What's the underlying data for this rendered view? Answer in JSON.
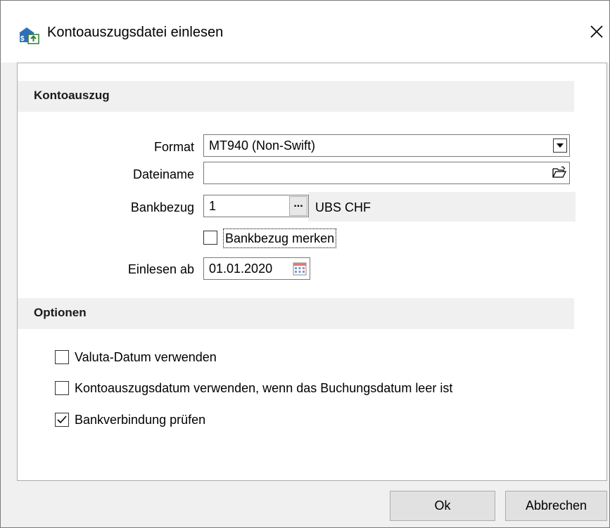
{
  "window": {
    "title": "Kontoauszugsdatei einlesen",
    "icon": "bank-import-icon",
    "close_icon": "close-icon"
  },
  "section_kontoauszug": {
    "header": "Kontoauszug",
    "format_label": "Format",
    "format_value": "MT940 (Non-Swift)",
    "dateiname_label": "Dateiname",
    "dateiname_value": "",
    "bankbezug_label": "Bankbezug",
    "bankbezug_value": "1",
    "bankbezug_button": "...",
    "bankbezug_name": "UBS CHF",
    "bankbezug_merken_label": "Bankbezug merken",
    "bankbezug_merken_checked": false,
    "einlesen_ab_label": "Einlesen ab",
    "einlesen_ab_value": "01.01.2020"
  },
  "section_optionen": {
    "header": "Optionen",
    "options": [
      {
        "label": "Valuta-Datum verwenden",
        "checked": false
      },
      {
        "label": "Kontoauszugsdatum verwenden, wenn das Buchungsdatum leer ist",
        "checked": false
      },
      {
        "label": "Bankverbindung prüfen",
        "checked": true
      }
    ]
  },
  "buttons": {
    "ok": "Ok",
    "cancel": "Abbrechen"
  },
  "colors": {
    "dialog_bg": "#f0f0f0",
    "panel_bg": "#ffffff",
    "section_header_bg": "#f0f0f0",
    "button_bg": "#e1e1e1",
    "border": "#7a7a7a"
  }
}
